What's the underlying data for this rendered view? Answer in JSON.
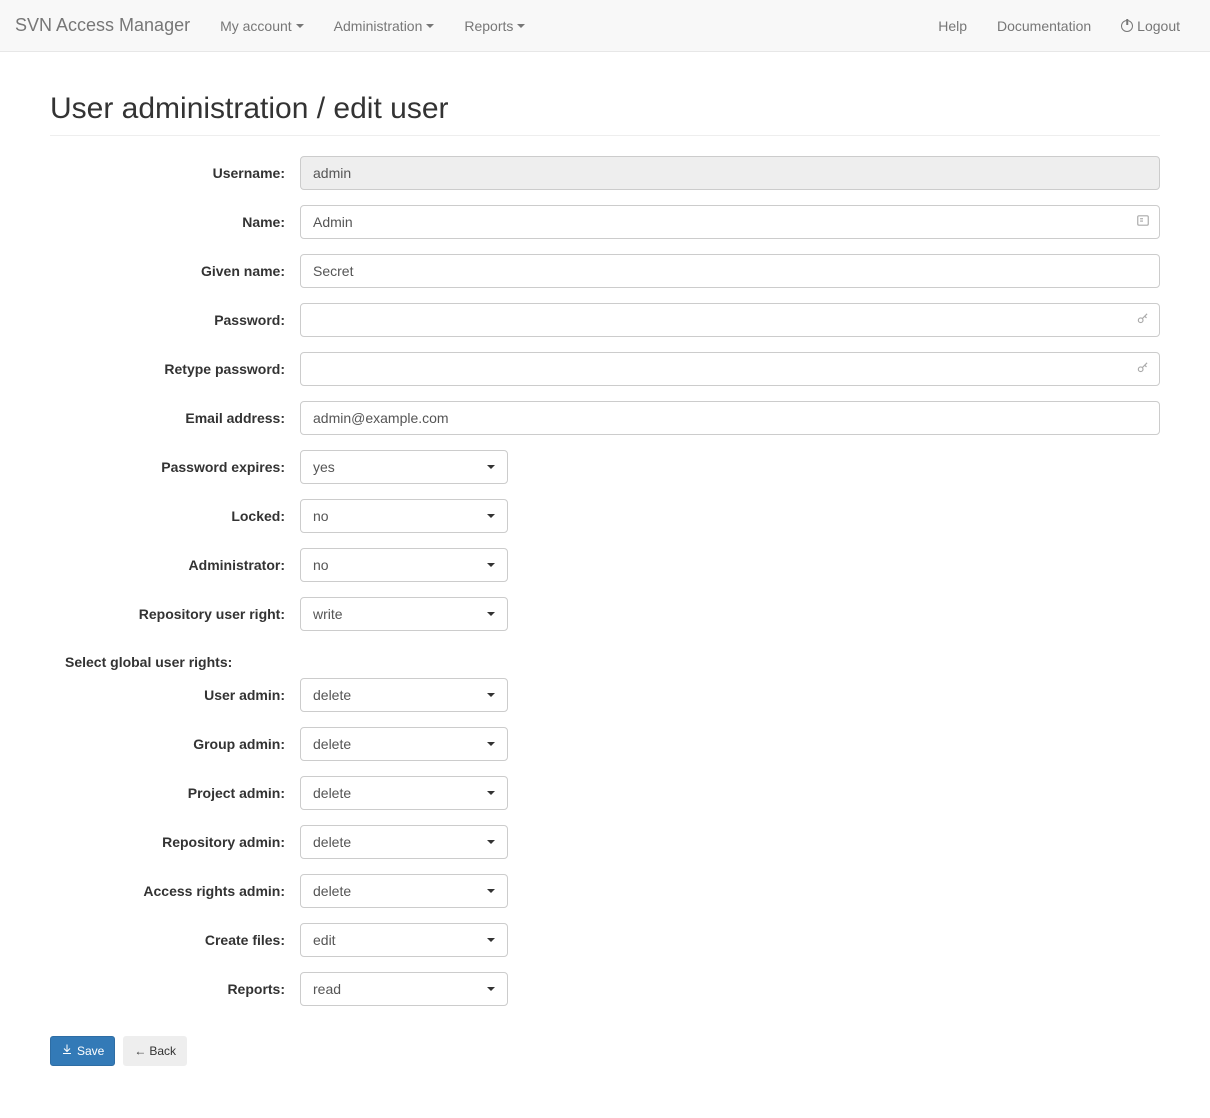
{
  "navbar": {
    "brand": "SVN Access Manager",
    "left_items": [
      {
        "label": "My account",
        "dropdown": true
      },
      {
        "label": "Administration",
        "dropdown": true
      },
      {
        "label": "Reports",
        "dropdown": true
      }
    ],
    "right_items": [
      {
        "label": "Help"
      },
      {
        "label": "Documentation"
      },
      {
        "label": "Logout",
        "icon": "power"
      }
    ]
  },
  "page_title": "User administration / edit user",
  "form": {
    "fields": {
      "username": {
        "label": "Username:",
        "value": "admin",
        "disabled": true
      },
      "name": {
        "label": "Name:",
        "value": "Admin"
      },
      "given_name": {
        "label": "Given name:",
        "value": "Secret"
      },
      "password": {
        "label": "Password:",
        "value": ""
      },
      "retype_password": {
        "label": "Retype password:",
        "value": ""
      },
      "email": {
        "label": "Email address:",
        "value": "admin@example.com"
      },
      "password_expires": {
        "label": "Password expires:",
        "value": "yes"
      },
      "locked": {
        "label": "Locked:",
        "value": "no"
      },
      "administrator": {
        "label": "Administrator:",
        "value": "no"
      },
      "repo_user_right": {
        "label": "Repository user right:",
        "value": "write"
      }
    },
    "global_rights_heading": "Select global user rights:",
    "global_rights": {
      "user_admin": {
        "label": "User admin:",
        "value": "delete"
      },
      "group_admin": {
        "label": "Group admin:",
        "value": "delete"
      },
      "project_admin": {
        "label": "Project admin:",
        "value": "delete"
      },
      "repository_admin": {
        "label": "Repository admin:",
        "value": "delete"
      },
      "access_rights_admin": {
        "label": "Access rights admin:",
        "value": "delete"
      },
      "create_files": {
        "label": "Create files:",
        "value": "edit"
      },
      "reports": {
        "label": "Reports:",
        "value": "read"
      }
    }
  },
  "buttons": {
    "save": "Save",
    "back": "Back"
  }
}
